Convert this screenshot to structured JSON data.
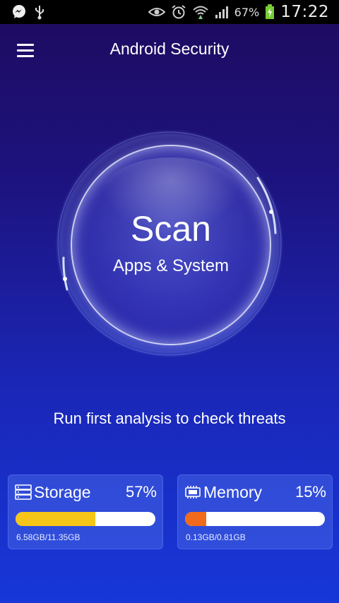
{
  "status_bar": {
    "icons": [
      "messenger-icon",
      "usb-icon",
      "eye-icon",
      "alarm-icon",
      "wifi-icon",
      "signal-icon",
      "battery-charging-icon"
    ],
    "battery": "67%",
    "time": "17:22"
  },
  "app_bar": {
    "title": "Android Security",
    "menu_icon": "hamburger-icon"
  },
  "scan": {
    "title": "Scan",
    "subtitle": "Apps & System"
  },
  "hint": "Run first analysis to check threats",
  "storage": {
    "label": "Storage",
    "percent": "57%",
    "fill": 0.57,
    "detail": "6.58GB/11.35GB",
    "color": "#f5c518",
    "icon": "storage-icon"
  },
  "memory": {
    "label": "Memory",
    "percent": "15%",
    "fill": 0.15,
    "detail": "0.13GB/0.81GB",
    "color": "#f26a1b",
    "icon": "memory-chip-icon"
  },
  "colors": {
    "background_top": "#1e0b5e",
    "background_bottom": "#1737d8"
  }
}
